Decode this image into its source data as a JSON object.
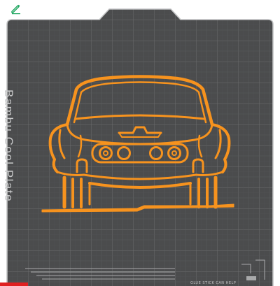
{
  "toolbar": {
    "edit_icon": "pencil-icon",
    "accent_color": "#17a35a"
  },
  "plate": {
    "label": "Bambu Cool Plate",
    "footer_text": "GLUE STICK CAN HELP",
    "plate_color": "#4b4c4d",
    "grid_color": "#6e6f70",
    "border_color": "#bfc0c1"
  },
  "model": {
    "name": "car-front-silhouette",
    "color": "#f7931e"
  }
}
